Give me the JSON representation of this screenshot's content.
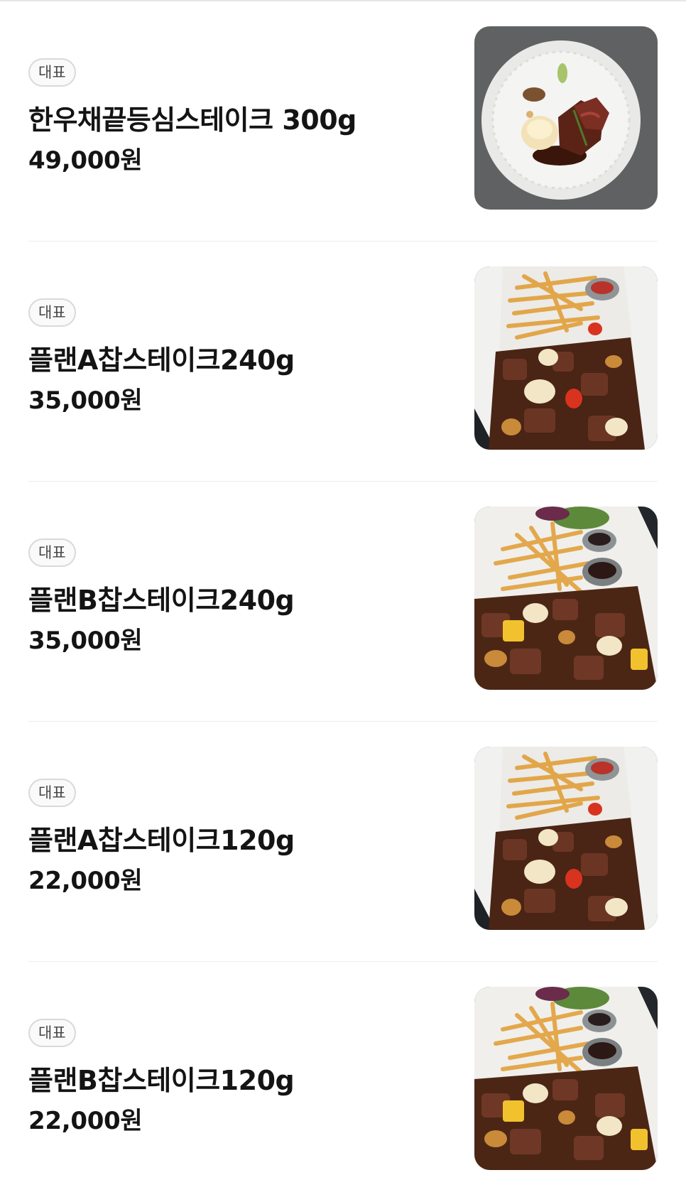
{
  "menu": {
    "items": [
      {
        "badge": "대표",
        "name": "한우채끝등심스테이크 300g",
        "price": "49,000원",
        "photo": "plated-steak-photo"
      },
      {
        "badge": "대표",
        "name": "플랜A찹스테이크240g",
        "price": "35,000원",
        "photo": "chop-steak-fries-photo"
      },
      {
        "badge": "대표",
        "name": "플랜B찹스테이크240g",
        "price": "35,000원",
        "photo": "chop-steak-fries-salad-photo"
      },
      {
        "badge": "대표",
        "name": "플랜A찹스테이크120g",
        "price": "22,000원",
        "photo": "chop-steak-fries-photo"
      },
      {
        "badge": "대표",
        "name": "플랜B찹스테이크120g",
        "price": "22,000원",
        "photo": "chop-steak-fries-salad-photo"
      }
    ]
  }
}
